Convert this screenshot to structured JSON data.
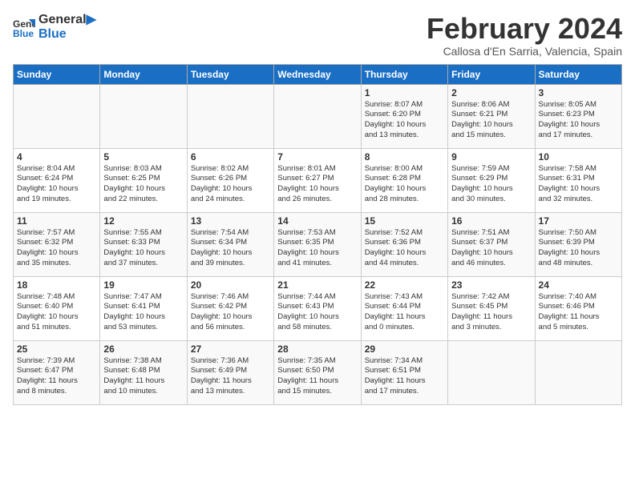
{
  "header": {
    "logo_line1": "General",
    "logo_line2": "Blue",
    "month": "February 2024",
    "location": "Callosa d'En Sarria, Valencia, Spain"
  },
  "days_of_week": [
    "Sunday",
    "Monday",
    "Tuesday",
    "Wednesday",
    "Thursday",
    "Friday",
    "Saturday"
  ],
  "weeks": [
    [
      {
        "day": "",
        "text": ""
      },
      {
        "day": "",
        "text": ""
      },
      {
        "day": "",
        "text": ""
      },
      {
        "day": "",
        "text": ""
      },
      {
        "day": "1",
        "text": "Sunrise: 8:07 AM\nSunset: 6:20 PM\nDaylight: 10 hours\nand 13 minutes."
      },
      {
        "day": "2",
        "text": "Sunrise: 8:06 AM\nSunset: 6:21 PM\nDaylight: 10 hours\nand 15 minutes."
      },
      {
        "day": "3",
        "text": "Sunrise: 8:05 AM\nSunset: 6:23 PM\nDaylight: 10 hours\nand 17 minutes."
      }
    ],
    [
      {
        "day": "4",
        "text": "Sunrise: 8:04 AM\nSunset: 6:24 PM\nDaylight: 10 hours\nand 19 minutes."
      },
      {
        "day": "5",
        "text": "Sunrise: 8:03 AM\nSunset: 6:25 PM\nDaylight: 10 hours\nand 22 minutes."
      },
      {
        "day": "6",
        "text": "Sunrise: 8:02 AM\nSunset: 6:26 PM\nDaylight: 10 hours\nand 24 minutes."
      },
      {
        "day": "7",
        "text": "Sunrise: 8:01 AM\nSunset: 6:27 PM\nDaylight: 10 hours\nand 26 minutes."
      },
      {
        "day": "8",
        "text": "Sunrise: 8:00 AM\nSunset: 6:28 PM\nDaylight: 10 hours\nand 28 minutes."
      },
      {
        "day": "9",
        "text": "Sunrise: 7:59 AM\nSunset: 6:29 PM\nDaylight: 10 hours\nand 30 minutes."
      },
      {
        "day": "10",
        "text": "Sunrise: 7:58 AM\nSunset: 6:31 PM\nDaylight: 10 hours\nand 32 minutes."
      }
    ],
    [
      {
        "day": "11",
        "text": "Sunrise: 7:57 AM\nSunset: 6:32 PM\nDaylight: 10 hours\nand 35 minutes."
      },
      {
        "day": "12",
        "text": "Sunrise: 7:55 AM\nSunset: 6:33 PM\nDaylight: 10 hours\nand 37 minutes."
      },
      {
        "day": "13",
        "text": "Sunrise: 7:54 AM\nSunset: 6:34 PM\nDaylight: 10 hours\nand 39 minutes."
      },
      {
        "day": "14",
        "text": "Sunrise: 7:53 AM\nSunset: 6:35 PM\nDaylight: 10 hours\nand 41 minutes."
      },
      {
        "day": "15",
        "text": "Sunrise: 7:52 AM\nSunset: 6:36 PM\nDaylight: 10 hours\nand 44 minutes."
      },
      {
        "day": "16",
        "text": "Sunrise: 7:51 AM\nSunset: 6:37 PM\nDaylight: 10 hours\nand 46 minutes."
      },
      {
        "day": "17",
        "text": "Sunrise: 7:50 AM\nSunset: 6:39 PM\nDaylight: 10 hours\nand 48 minutes."
      }
    ],
    [
      {
        "day": "18",
        "text": "Sunrise: 7:48 AM\nSunset: 6:40 PM\nDaylight: 10 hours\nand 51 minutes."
      },
      {
        "day": "19",
        "text": "Sunrise: 7:47 AM\nSunset: 6:41 PM\nDaylight: 10 hours\nand 53 minutes."
      },
      {
        "day": "20",
        "text": "Sunrise: 7:46 AM\nSunset: 6:42 PM\nDaylight: 10 hours\nand 56 minutes."
      },
      {
        "day": "21",
        "text": "Sunrise: 7:44 AM\nSunset: 6:43 PM\nDaylight: 10 hours\nand 58 minutes."
      },
      {
        "day": "22",
        "text": "Sunrise: 7:43 AM\nSunset: 6:44 PM\nDaylight: 11 hours\nand 0 minutes."
      },
      {
        "day": "23",
        "text": "Sunrise: 7:42 AM\nSunset: 6:45 PM\nDaylight: 11 hours\nand 3 minutes."
      },
      {
        "day": "24",
        "text": "Sunrise: 7:40 AM\nSunset: 6:46 PM\nDaylight: 11 hours\nand 5 minutes."
      }
    ],
    [
      {
        "day": "25",
        "text": "Sunrise: 7:39 AM\nSunset: 6:47 PM\nDaylight: 11 hours\nand 8 minutes."
      },
      {
        "day": "26",
        "text": "Sunrise: 7:38 AM\nSunset: 6:48 PM\nDaylight: 11 hours\nand 10 minutes."
      },
      {
        "day": "27",
        "text": "Sunrise: 7:36 AM\nSunset: 6:49 PM\nDaylight: 11 hours\nand 13 minutes."
      },
      {
        "day": "28",
        "text": "Sunrise: 7:35 AM\nSunset: 6:50 PM\nDaylight: 11 hours\nand 15 minutes."
      },
      {
        "day": "29",
        "text": "Sunrise: 7:34 AM\nSunset: 6:51 PM\nDaylight: 11 hours\nand 17 minutes."
      },
      {
        "day": "",
        "text": ""
      },
      {
        "day": "",
        "text": ""
      }
    ]
  ]
}
